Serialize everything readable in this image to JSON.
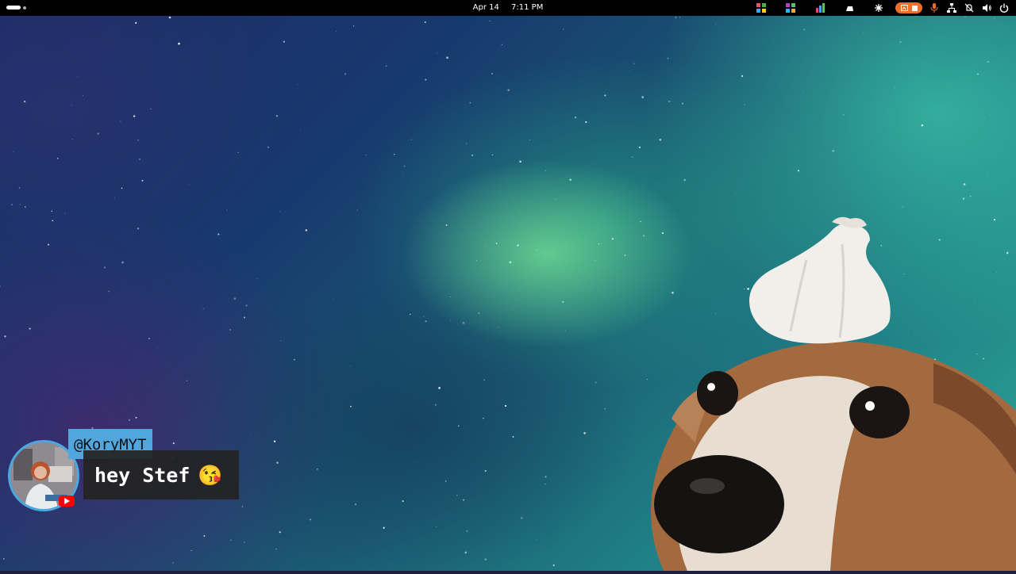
{
  "topbar": {
    "date": "Apr 14",
    "time": "7:11 PM",
    "tray_icons": [
      "app-indicator-icon",
      "app-indicator-icon",
      "app-indicator-icon",
      "dropbox-icon",
      "sync-icon",
      "screen-record-icon",
      "microphone-icon",
      "network-icon",
      "notifications-muted-icon",
      "volume-icon",
      "power-icon"
    ]
  },
  "chat": {
    "username": "@KoryMYT",
    "message": "hey Stef",
    "emoji": "😘",
    "platform": "youtube"
  },
  "colors": {
    "topbar_bg": "#000000",
    "username_bg": "#52a6de",
    "message_bg": "#232323",
    "record_indicator": "#e8702a",
    "youtube_red": "#ff0000"
  }
}
